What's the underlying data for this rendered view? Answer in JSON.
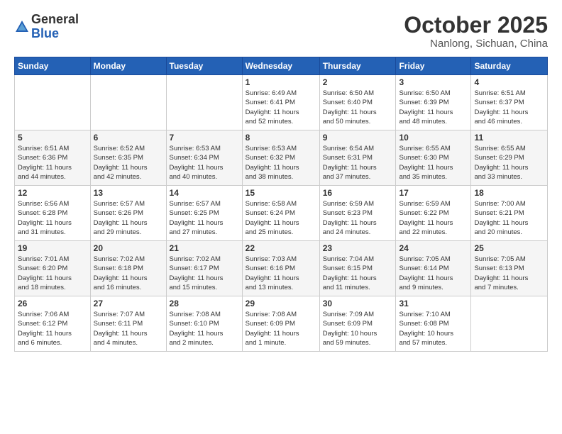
{
  "logo": {
    "general": "General",
    "blue": "Blue"
  },
  "header": {
    "month": "October 2025",
    "location": "Nanlong, Sichuan, China"
  },
  "weekdays": [
    "Sunday",
    "Monday",
    "Tuesday",
    "Wednesday",
    "Thursday",
    "Friday",
    "Saturday"
  ],
  "weeks": [
    [
      {
        "day": "",
        "info": ""
      },
      {
        "day": "",
        "info": ""
      },
      {
        "day": "",
        "info": ""
      },
      {
        "day": "1",
        "info": "Sunrise: 6:49 AM\nSunset: 6:41 PM\nDaylight: 11 hours\nand 52 minutes."
      },
      {
        "day": "2",
        "info": "Sunrise: 6:50 AM\nSunset: 6:40 PM\nDaylight: 11 hours\nand 50 minutes."
      },
      {
        "day": "3",
        "info": "Sunrise: 6:50 AM\nSunset: 6:39 PM\nDaylight: 11 hours\nand 48 minutes."
      },
      {
        "day": "4",
        "info": "Sunrise: 6:51 AM\nSunset: 6:37 PM\nDaylight: 11 hours\nand 46 minutes."
      }
    ],
    [
      {
        "day": "5",
        "info": "Sunrise: 6:51 AM\nSunset: 6:36 PM\nDaylight: 11 hours\nand 44 minutes."
      },
      {
        "day": "6",
        "info": "Sunrise: 6:52 AM\nSunset: 6:35 PM\nDaylight: 11 hours\nand 42 minutes."
      },
      {
        "day": "7",
        "info": "Sunrise: 6:53 AM\nSunset: 6:34 PM\nDaylight: 11 hours\nand 40 minutes."
      },
      {
        "day": "8",
        "info": "Sunrise: 6:53 AM\nSunset: 6:32 PM\nDaylight: 11 hours\nand 38 minutes."
      },
      {
        "day": "9",
        "info": "Sunrise: 6:54 AM\nSunset: 6:31 PM\nDaylight: 11 hours\nand 37 minutes."
      },
      {
        "day": "10",
        "info": "Sunrise: 6:55 AM\nSunset: 6:30 PM\nDaylight: 11 hours\nand 35 minutes."
      },
      {
        "day": "11",
        "info": "Sunrise: 6:55 AM\nSunset: 6:29 PM\nDaylight: 11 hours\nand 33 minutes."
      }
    ],
    [
      {
        "day": "12",
        "info": "Sunrise: 6:56 AM\nSunset: 6:28 PM\nDaylight: 11 hours\nand 31 minutes."
      },
      {
        "day": "13",
        "info": "Sunrise: 6:57 AM\nSunset: 6:26 PM\nDaylight: 11 hours\nand 29 minutes."
      },
      {
        "day": "14",
        "info": "Sunrise: 6:57 AM\nSunset: 6:25 PM\nDaylight: 11 hours\nand 27 minutes."
      },
      {
        "day": "15",
        "info": "Sunrise: 6:58 AM\nSunset: 6:24 PM\nDaylight: 11 hours\nand 25 minutes."
      },
      {
        "day": "16",
        "info": "Sunrise: 6:59 AM\nSunset: 6:23 PM\nDaylight: 11 hours\nand 24 minutes."
      },
      {
        "day": "17",
        "info": "Sunrise: 6:59 AM\nSunset: 6:22 PM\nDaylight: 11 hours\nand 22 minutes."
      },
      {
        "day": "18",
        "info": "Sunrise: 7:00 AM\nSunset: 6:21 PM\nDaylight: 11 hours\nand 20 minutes."
      }
    ],
    [
      {
        "day": "19",
        "info": "Sunrise: 7:01 AM\nSunset: 6:20 PM\nDaylight: 11 hours\nand 18 minutes."
      },
      {
        "day": "20",
        "info": "Sunrise: 7:02 AM\nSunset: 6:18 PM\nDaylight: 11 hours\nand 16 minutes."
      },
      {
        "day": "21",
        "info": "Sunrise: 7:02 AM\nSunset: 6:17 PM\nDaylight: 11 hours\nand 15 minutes."
      },
      {
        "day": "22",
        "info": "Sunrise: 7:03 AM\nSunset: 6:16 PM\nDaylight: 11 hours\nand 13 minutes."
      },
      {
        "day": "23",
        "info": "Sunrise: 7:04 AM\nSunset: 6:15 PM\nDaylight: 11 hours\nand 11 minutes."
      },
      {
        "day": "24",
        "info": "Sunrise: 7:05 AM\nSunset: 6:14 PM\nDaylight: 11 hours\nand 9 minutes."
      },
      {
        "day": "25",
        "info": "Sunrise: 7:05 AM\nSunset: 6:13 PM\nDaylight: 11 hours\nand 7 minutes."
      }
    ],
    [
      {
        "day": "26",
        "info": "Sunrise: 7:06 AM\nSunset: 6:12 PM\nDaylight: 11 hours\nand 6 minutes."
      },
      {
        "day": "27",
        "info": "Sunrise: 7:07 AM\nSunset: 6:11 PM\nDaylight: 11 hours\nand 4 minutes."
      },
      {
        "day": "28",
        "info": "Sunrise: 7:08 AM\nSunset: 6:10 PM\nDaylight: 11 hours\nand 2 minutes."
      },
      {
        "day": "29",
        "info": "Sunrise: 7:08 AM\nSunset: 6:09 PM\nDaylight: 11 hours\nand 1 minute."
      },
      {
        "day": "30",
        "info": "Sunrise: 7:09 AM\nSunset: 6:09 PM\nDaylight: 10 hours\nand 59 minutes."
      },
      {
        "day": "31",
        "info": "Sunrise: 7:10 AM\nSunset: 6:08 PM\nDaylight: 10 hours\nand 57 minutes."
      },
      {
        "day": "",
        "info": ""
      }
    ]
  ]
}
